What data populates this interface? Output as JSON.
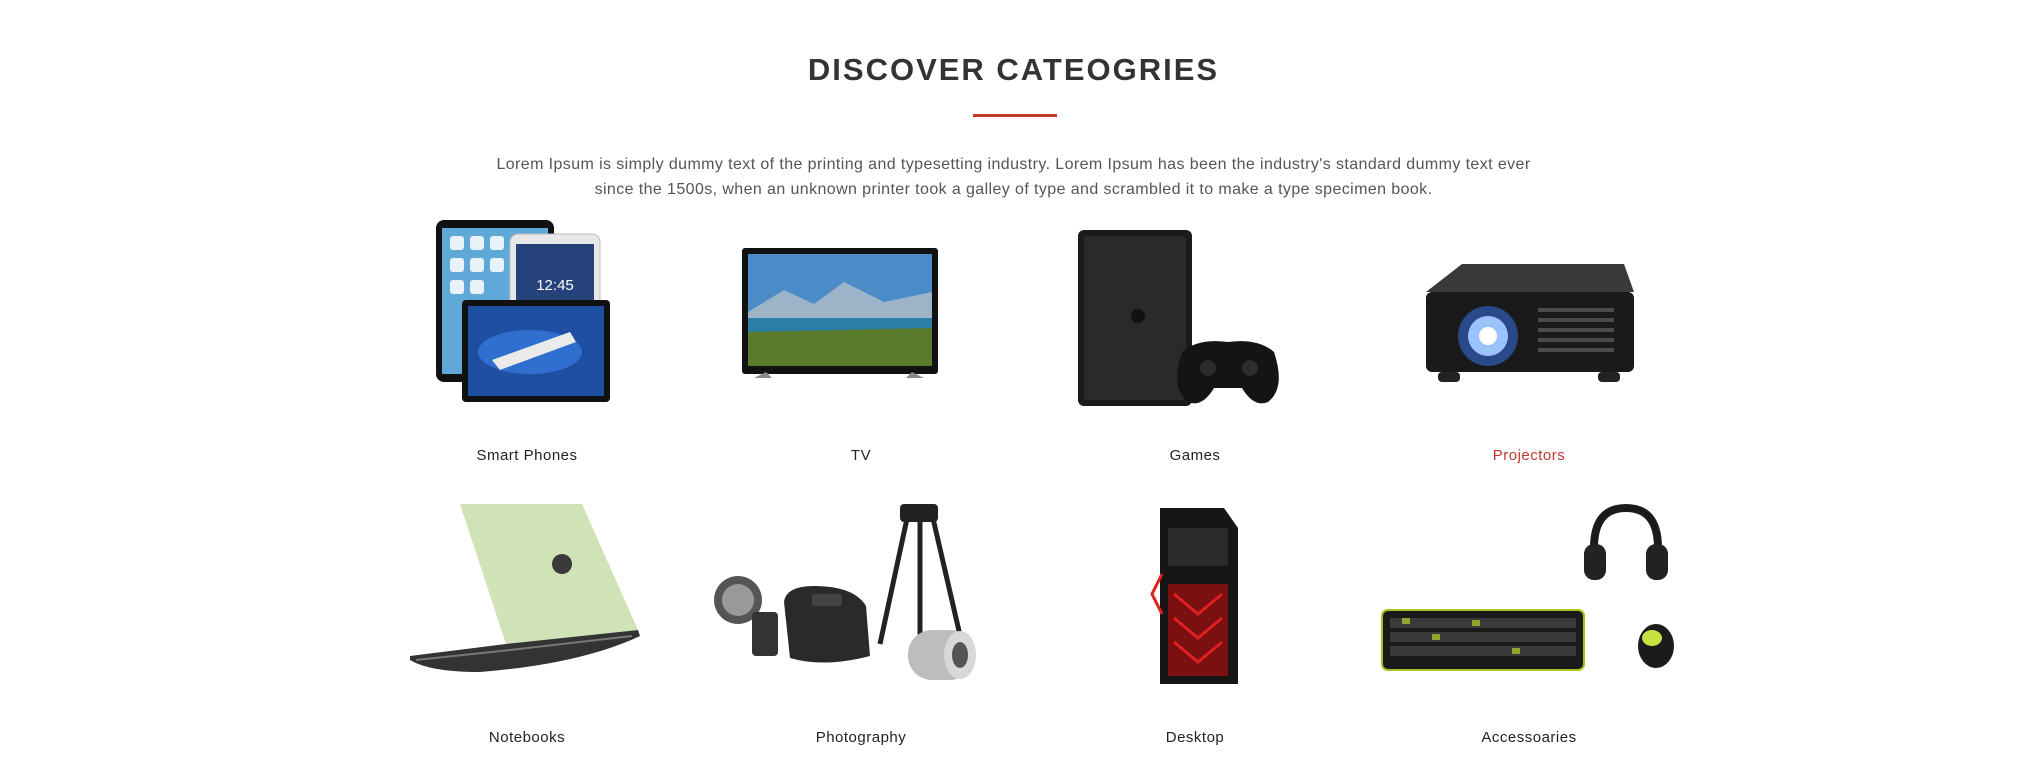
{
  "section": {
    "title": "DISCOVER CATEOGRIES",
    "description": "Lorem Ipsum is simply dummy text of the printing and typesetting industry. Lorem Ipsum has been the industry's standard dummy text ever since the 1500s, when an unknown printer took a galley of type and scrambled it to make a type specimen book.",
    "accent_color": "#c0392b"
  },
  "categories": [
    {
      "label": "Smart Phones",
      "icon": "tablets-image"
    },
    {
      "label": "TV",
      "icon": "tv-image"
    },
    {
      "label": "Games",
      "icon": "game-console-image"
    },
    {
      "label": "Projectors",
      "icon": "projector-image"
    },
    {
      "label": "Notebooks",
      "icon": "laptop-image"
    },
    {
      "label": "Photography",
      "icon": "camera-gear-image"
    },
    {
      "label": "Desktop",
      "icon": "desktop-tower-image"
    },
    {
      "label": "Accessoaries",
      "icon": "keyboard-headphones-image"
    }
  ]
}
